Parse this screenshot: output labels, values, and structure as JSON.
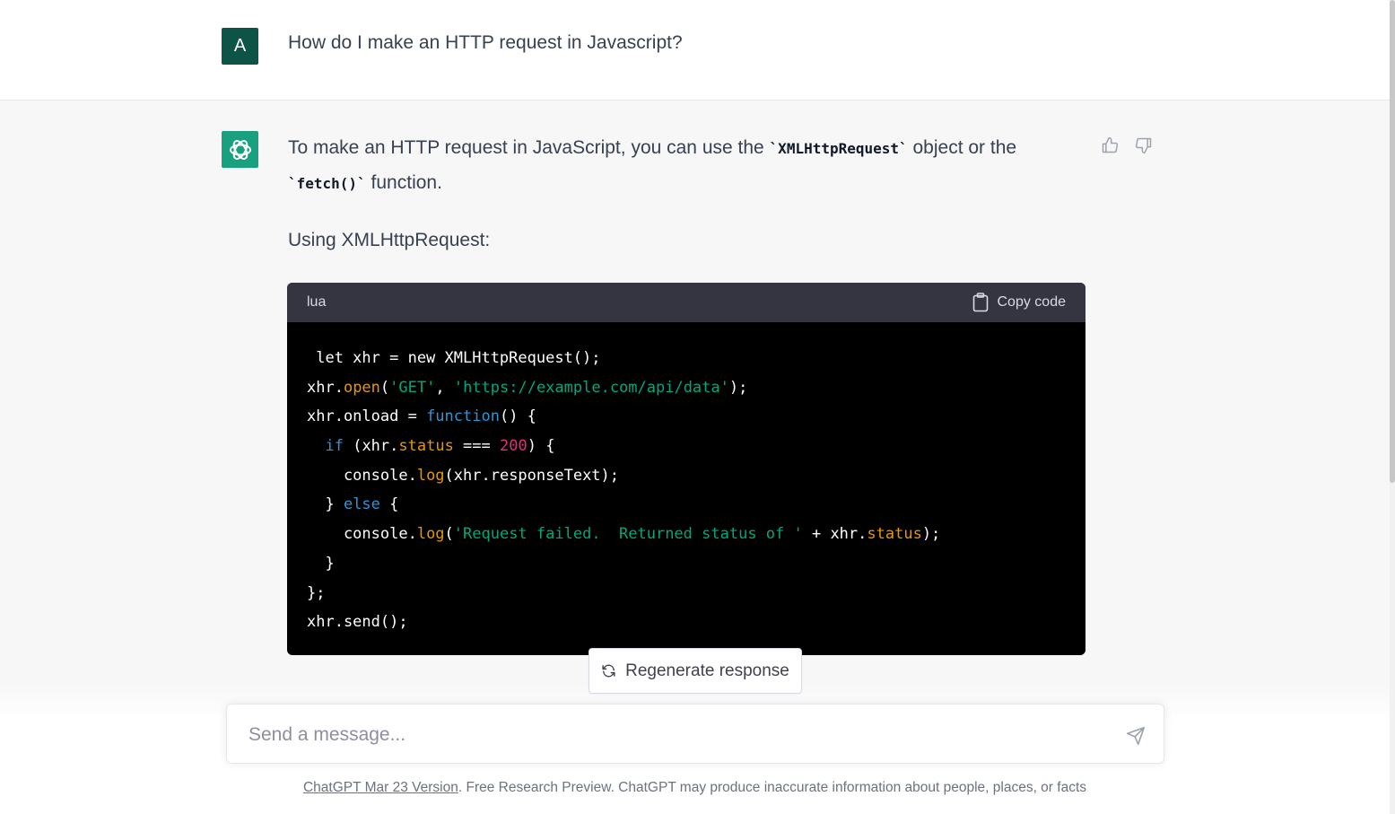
{
  "user": {
    "avatar_letter": "A",
    "message": "How do I make an HTTP request in Javascript?"
  },
  "assistant": {
    "intro_part1": "To make an HTTP request in JavaScript, you can use the ",
    "intro_code1": "`XMLHttpRequest`",
    "intro_part2": " object or the ",
    "intro_code2": "`fetch()`",
    "intro_part3": " function.",
    "subheading": "Using XMLHttpRequest:",
    "code_block": {
      "language": "lua",
      "copy_label": "Copy code",
      "lines": [
        [
          {
            "t": " let xhr = new XMLHttpRequest();",
            "c": ""
          }
        ],
        [
          {
            "t": "xhr.",
            "c": ""
          },
          {
            "t": "open",
            "c": "tok-fn"
          },
          {
            "t": "(",
            "c": ""
          },
          {
            "t": "'GET'",
            "c": "tok-str"
          },
          {
            "t": ", ",
            "c": ""
          },
          {
            "t": "'https://example.com/api/data'",
            "c": "tok-str"
          },
          {
            "t": ");",
            "c": ""
          }
        ],
        [
          {
            "t": "xhr.onload = ",
            "c": ""
          },
          {
            "t": "function",
            "c": "tok-kw"
          },
          {
            "t": "() {",
            "c": ""
          }
        ],
        [
          {
            "t": "  ",
            "c": ""
          },
          {
            "t": "if",
            "c": "tok-kw"
          },
          {
            "t": " (xhr.",
            "c": ""
          },
          {
            "t": "status",
            "c": "tok-fn"
          },
          {
            "t": " === ",
            "c": ""
          },
          {
            "t": "200",
            "c": "tok-num"
          },
          {
            "t": ") {",
            "c": ""
          }
        ],
        [
          {
            "t": "    console.",
            "c": ""
          },
          {
            "t": "log",
            "c": "tok-fn"
          },
          {
            "t": "(xhr.responseText);",
            "c": ""
          }
        ],
        [
          {
            "t": "  } ",
            "c": ""
          },
          {
            "t": "else",
            "c": "tok-kw"
          },
          {
            "t": " {",
            "c": ""
          }
        ],
        [
          {
            "t": "    console.",
            "c": ""
          },
          {
            "t": "log",
            "c": "tok-fn"
          },
          {
            "t": "(",
            "c": ""
          },
          {
            "t": "'Request failed.  Returned status of '",
            "c": "tok-str"
          },
          {
            "t": " + xhr.",
            "c": ""
          },
          {
            "t": "status",
            "c": "tok-fn"
          },
          {
            "t": ");",
            "c": ""
          }
        ],
        [
          {
            "t": "  }",
            "c": ""
          }
        ],
        [
          {
            "t": "};",
            "c": ""
          }
        ],
        [
          {
            "t": "xhr.send();",
            "c": ""
          }
        ]
      ]
    }
  },
  "controls": {
    "regenerate_label": "Regenerate response",
    "input_placeholder": "Send a message...",
    "footer_link": "ChatGPT Mar 23 Version",
    "footer_text": ". Free Research Preview. ChatGPT may produce inaccurate information about people, places, or facts"
  },
  "colors": {
    "user_avatar": "#0d5446",
    "bot_avatar": "#19a07f",
    "code_bg": "#000000",
    "code_header_bg": "#343541"
  },
  "icons": [
    "openai-logo-icon",
    "thumbs-up-icon",
    "thumbs-down-icon",
    "clipboard-icon",
    "refresh-icon",
    "arrow-down-icon",
    "send-icon"
  ]
}
